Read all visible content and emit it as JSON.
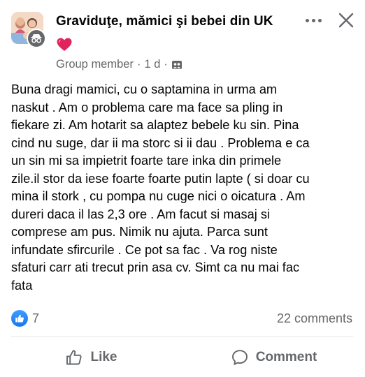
{
  "post": {
    "group_name": "Graviduţe, mămici şi bebei din UK",
    "author_role": "Group member",
    "separator": "·",
    "time_ago": "1 d",
    "audience_icon": "group-audience-icon",
    "text": "Buna dragi mamici, cu o saptamina in urma am\nnaskut . Am o problema care ma face sa pling in\nfiekare zi. Am hotarit sa alaptez bebele ku sin. Pina\ncind nu suge, dar ii ma storc si ii dau . Problema e ca\nun sin mi sa impietrit foarte tare inka din primele\nzile.il stor da iese foarte foarte putin lapte ( si doar cu\nmina il stork , cu pompa nu cuge nici o oicatura . Am\ndureri daca il las 2,3 ore . Am facut si masaj si\ncomprese am pus. Nimik nu ajuta. Parca sunt\ninfundate sfircurile . Ce pot sa fac . Va rog niste\nsfaturi carr ati trecut prin asa cv. Simt ca nu mai fac\nfata",
    "reaction_count": "7",
    "comments_count": "22 comments"
  },
  "actions": {
    "like_label": "Like",
    "comment_label": "Comment"
  },
  "colors": {
    "primary_text": "#050505",
    "secondary_text": "#65676b",
    "like_blue": "#1877f2",
    "heart_red": "#e0245e",
    "divider": "#e4e6eb"
  }
}
